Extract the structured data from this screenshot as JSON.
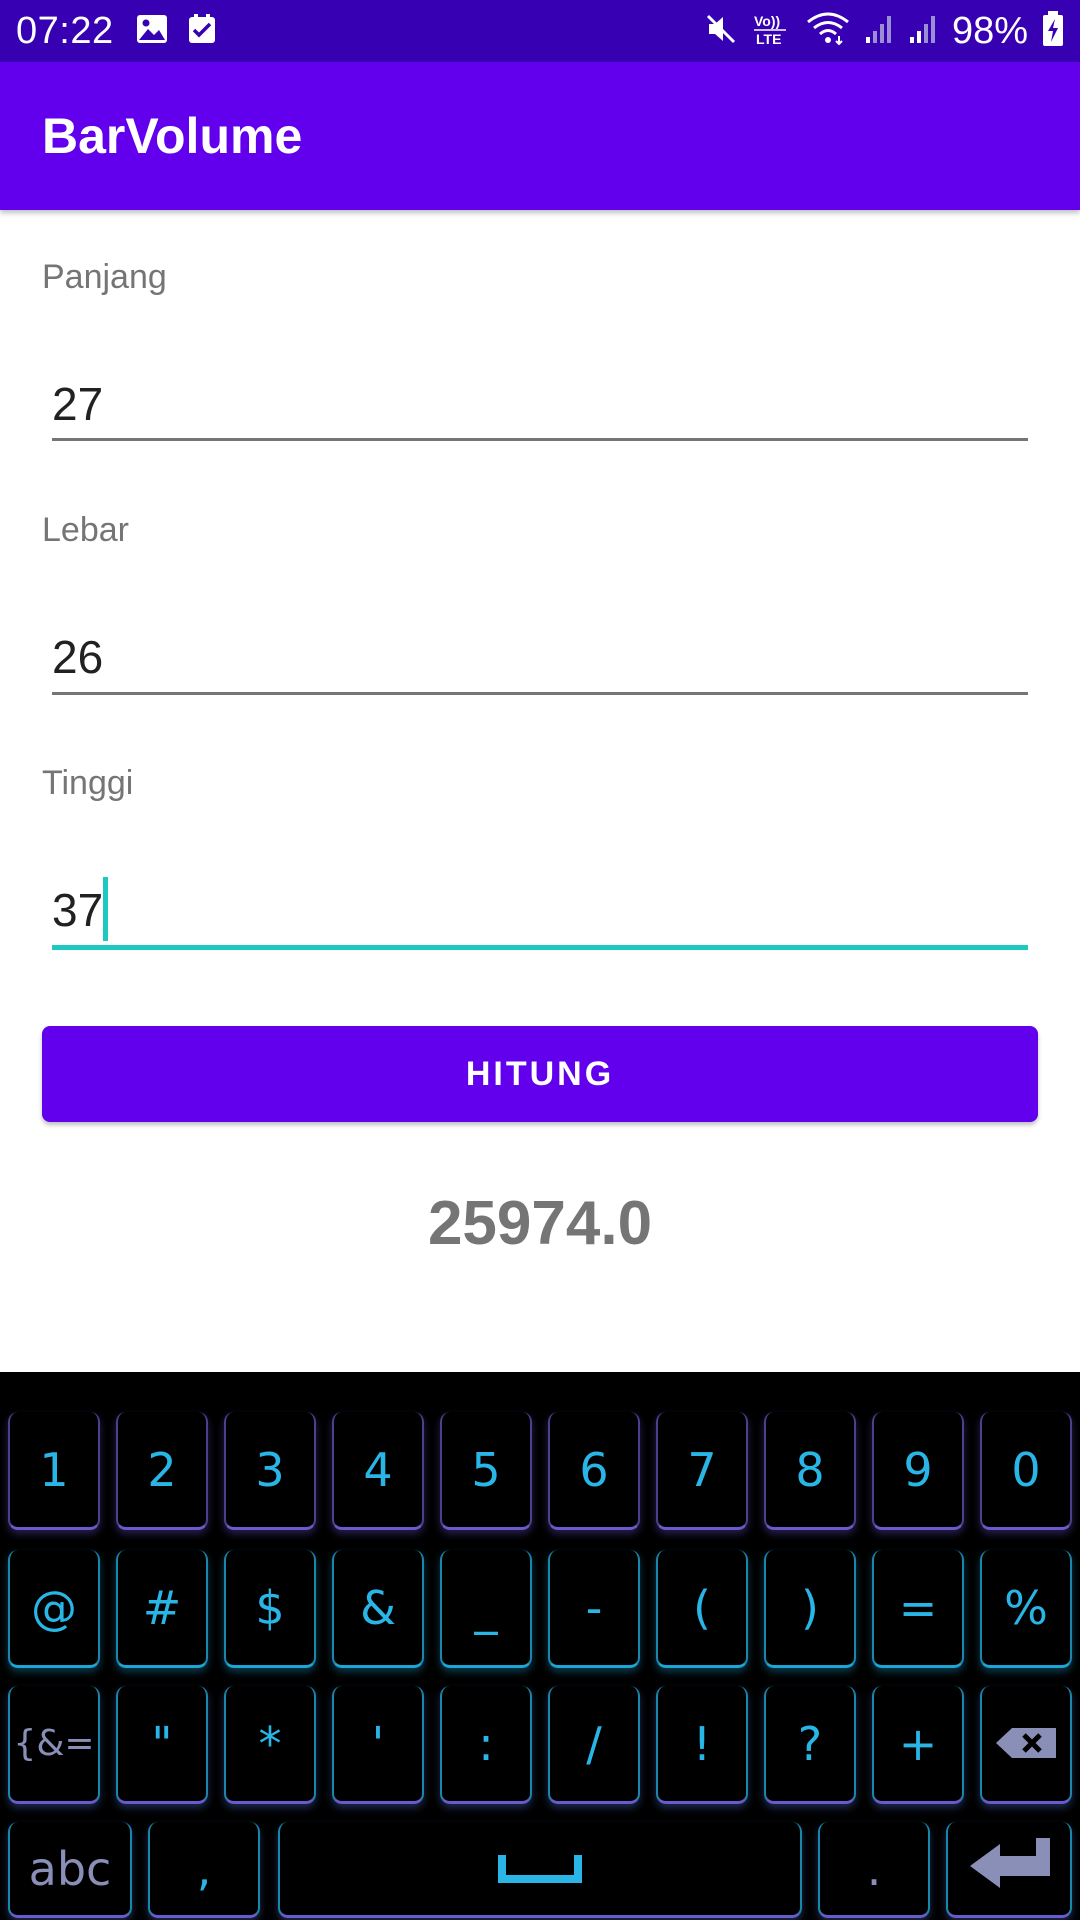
{
  "status_bar": {
    "time": "07:22",
    "battery": "98%",
    "icons": [
      "image-icon",
      "checkbox-icon",
      "mute-icon",
      "volte-icon",
      "wifi-icon",
      "signal-icon",
      "signal-icon-2",
      "battery-charging-icon"
    ],
    "volte_text": "Vo)) LTE"
  },
  "app_bar": {
    "title": "BarVolume"
  },
  "form": {
    "panjang": {
      "label": "Panjang",
      "value": "27"
    },
    "lebar": {
      "label": "Lebar",
      "value": "26"
    },
    "tinggi": {
      "label": "Tinggi",
      "value": "37"
    }
  },
  "button": {
    "label": "HITUNG"
  },
  "result": {
    "value": "25974.0"
  },
  "keyboard": {
    "row1": [
      "1",
      "2",
      "3",
      "4",
      "5",
      "6",
      "7",
      "8",
      "9",
      "0"
    ],
    "row2": [
      "@",
      "#",
      "$",
      "&",
      "_",
      "-",
      "(",
      ")",
      "=",
      "%"
    ],
    "row3": [
      "{&=",
      "\"",
      "*",
      "'",
      ":",
      "/",
      "!",
      "?",
      "+"
    ],
    "row4": {
      "abc": "abc",
      "comma": ",",
      "period": "."
    },
    "icons": [
      "backspace-icon",
      "space-icon",
      "enter-icon"
    ]
  },
  "colors": {
    "status_bar": "#3700b3",
    "primary": "#6200ee",
    "accent": "#1cc8c0",
    "key_text": "#29b6e6"
  }
}
